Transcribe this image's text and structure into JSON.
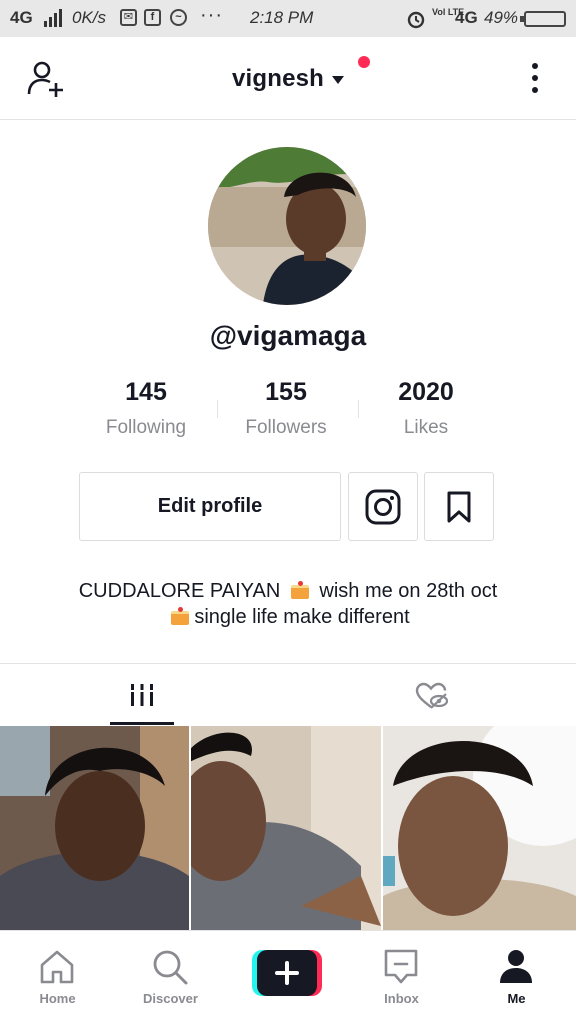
{
  "status_bar": {
    "signal": "4G",
    "speed": "0K/s",
    "time": "2:18 PM",
    "volte": "Vol LTE",
    "network": "4G",
    "battery": "49%"
  },
  "header": {
    "username": "vignesh"
  },
  "profile": {
    "handle": "@vigamaga",
    "stats": [
      {
        "value": "145",
        "label": "Following"
      },
      {
        "value": "155",
        "label": "Followers"
      },
      {
        "value": "2020",
        "label": "Likes"
      }
    ],
    "edit_label": "Edit profile",
    "bio_line1_a": "CUDDALORE PAIYAN",
    "bio_line1_b": "wish me on 28th oct",
    "bio_line2": "single life make different"
  },
  "bottom_nav": [
    {
      "label": "Home",
      "icon": "home-icon"
    },
    {
      "label": "Discover",
      "icon": "search-icon"
    },
    {
      "label": "",
      "icon": "plus-icon"
    },
    {
      "label": "Inbox",
      "icon": "inbox-icon"
    },
    {
      "label": "Me",
      "icon": "profile-icon"
    }
  ],
  "colors": {
    "accent": "#fe2c55",
    "text": "#161823",
    "muted": "#8a8b91",
    "status_bar_bg": "#e8e8e8"
  }
}
